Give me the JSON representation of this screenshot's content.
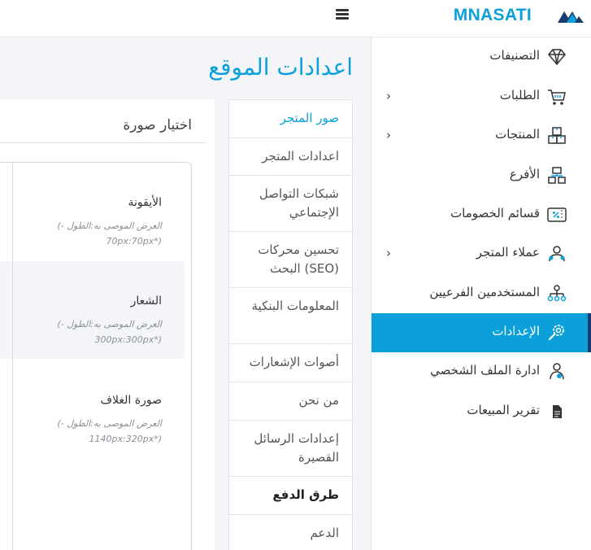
{
  "header": {
    "brand": "MNASATI",
    "logo_icon": "mnasati-logo-icon",
    "menu_icon": "hamburger-icon"
  },
  "sidebar": {
    "items": [
      {
        "label": "التصنيفات",
        "icon": "diamond-icon",
        "has_chevron": false,
        "active": false
      },
      {
        "label": "الطلبات",
        "icon": "cart-icon",
        "has_chevron": true,
        "active": false
      },
      {
        "label": "المنتجات",
        "icon": "boxes-icon",
        "has_chevron": true,
        "active": false
      },
      {
        "label": "الأفرع",
        "icon": "branches-icon",
        "has_chevron": false,
        "active": false
      },
      {
        "label": "قسائم الخصومات",
        "icon": "coupon-icon",
        "has_chevron": false,
        "active": false
      },
      {
        "label": "عملاء المتجر",
        "icon": "customers-icon",
        "has_chevron": true,
        "active": false
      },
      {
        "label": "المستخدمين الفرعيين",
        "icon": "sub-users-icon",
        "has_chevron": false,
        "active": false
      },
      {
        "label": "الإعدادات",
        "icon": "settings-gear-icon",
        "has_chevron": false,
        "active": true
      },
      {
        "label": "ادارة الملف الشخصي",
        "icon": "profile-icon",
        "has_chevron": false,
        "active": false
      },
      {
        "label": "تقرير المبيعات",
        "icon": "report-icon",
        "has_chevron": false,
        "active": false
      }
    ],
    "chevron_glyph": "›"
  },
  "page": {
    "title": "اعدادات الموقع"
  },
  "tabs": [
    {
      "label": "صور المتجر",
      "active": true
    },
    {
      "label": "اعدادات المتجر"
    },
    {
      "label": "شبكات التواصل الإجتماعي"
    },
    {
      "label": "تحسين محركات البحث (SEO)"
    },
    {
      "label": "المعلومات البنكية"
    },
    {
      "label": "أصوات الإشعارات"
    },
    {
      "label": "من نحن"
    },
    {
      "label": "إعدادات الرسائل القصيرة"
    },
    {
      "label": "طرق الدفع",
      "bold": true
    },
    {
      "label": "الدعم"
    }
  ],
  "content": {
    "title": "اختيار صورة",
    "rows": [
      {
        "label": "الأيقونة",
        "hint": "(العرض الموصى به:الطول - 70px:70px*)"
      },
      {
        "label": "الشعار",
        "hint": "(العرض الموصى به:الطول - 300px:300px*)"
      },
      {
        "label": "صورة الغلاف",
        "hint": "(العرض الموصى به:الطول - 1140px:320px*)"
      }
    ]
  },
  "colors": {
    "accent": "#0ba0d9",
    "active_edge": "#1b3b6f",
    "page_bg": "#f4f5f8"
  }
}
